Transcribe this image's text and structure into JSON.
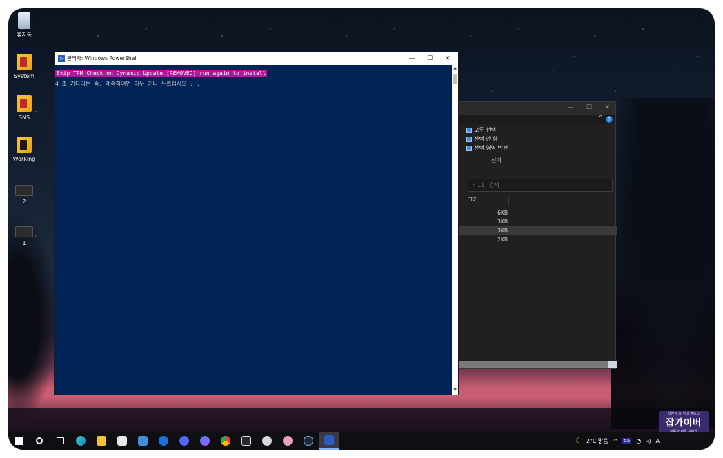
{
  "desktop": {
    "icons": [
      {
        "label": "휴지통",
        "icon": "recycle-bin-icon"
      },
      {
        "label": "System",
        "icon": "folder-icon"
      },
      {
        "label": "SNS",
        "icon": "folder-icon"
      },
      {
        "label": "Working",
        "icon": "folder-icon"
      },
      {
        "label": "2",
        "icon": "thumbnail-icon"
      },
      {
        "label": "1",
        "icon": "thumbnail-icon"
      }
    ]
  },
  "powershell": {
    "title": "관리자: Windows PowerShell",
    "line1": "Skip TPM Check on Dynamic Update [REMOVED] run again to install",
    "line2": "4 초 기다리는 중, 계속하려면 아무 키나 누르십시오 ...",
    "minimize": "—",
    "maximize": "☐",
    "close": "✕"
  },
  "explorer": {
    "menu": [
      "모두 선택",
      "선택 안 함",
      "선택 영역 반전"
    ],
    "group_label": "선택",
    "search_placeholder": "11_ 검색",
    "column_header": "크기",
    "sizes": [
      "6KB",
      "3KB",
      "3KB",
      "2KB"
    ],
    "selected_row": 2
  },
  "watermark": {
    "top": "착한킹 IT 취미 블로그",
    "main": "잡가이버",
    "bottom": "부동산·세금 자린게"
  },
  "taskbar": {
    "weather": "2°C 맑음",
    "tray_number": "55",
    "ime": "A",
    "colors": {
      "accent": "#7fb4ff",
      "ps_bg": "#012456",
      "highlight": "#b5159a"
    }
  }
}
